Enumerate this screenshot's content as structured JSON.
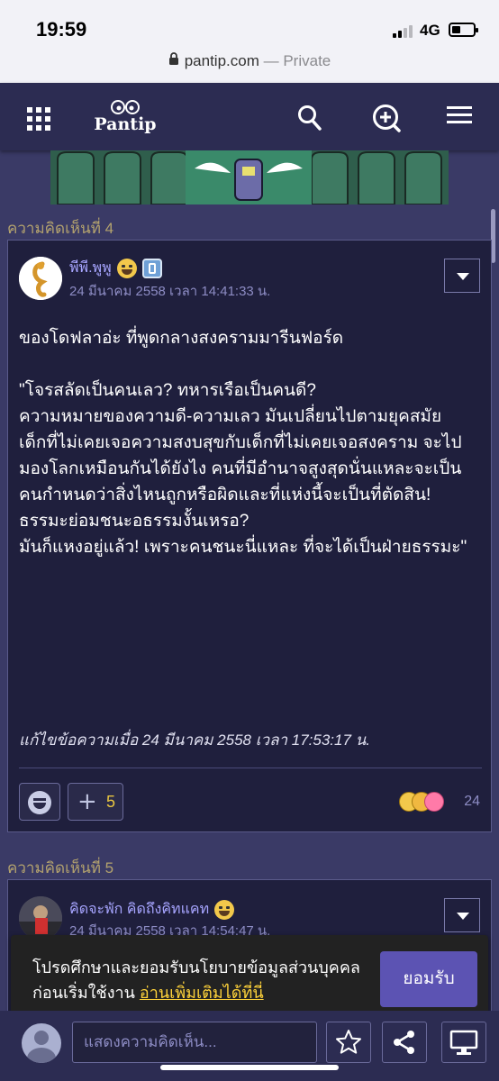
{
  "status_bar": {
    "time": "19:59",
    "network": "4G"
  },
  "url_bar": {
    "domain": "pantip.com",
    "separator": " — ",
    "mode": "Private"
  },
  "header": {
    "logo_text": "Pantip",
    "icons": [
      "grid-icon",
      "search-icon",
      "new-post-icon",
      "menu-icon"
    ]
  },
  "comments": [
    {
      "label": "ความคิดเห็นที่ 4",
      "user": "พีพี.พูพู",
      "time": "24 มีนาคม 2558 เวลา 14:41:33 น.",
      "body": [
        "ของโดฟลาอ่ะ ที่พูดกลางสงครามมารีนฟอร์ด",
        "",
        "\"โจรสลัดเป็นคนเลว? ทหารเรือเป็นคนดี?",
        "ความหมายของความดี-ความเลว มันเปลี่ยนไปตามยุคสมัย",
        "เด็กที่ไม่เคยเจอความสงบสุขกับเด็กที่ไม่เคยเจอสงคราม จะไปมองโลกเหมือนกันได้ยังไง คนที่มีอำนาจสูงสุดนั่นแหละจะเป็นคนกำหนดว่าสิ่งไหนถูกหรือผิดและที่แห่งนี้จะเป็นที่ตัดสิน!",
        "ธรรมะย่อมชนะอธรรมงั้นเหรอ?",
        "มันก็แหงอยู่แล้ว! เพราะคนชนะนี่แหละ ที่จะได้เป็นฝ่ายธรรมะ\""
      ],
      "edit_note": "แก้ไขข้อความเมื่อ 24 มีนาคม 2558 เวลา 17:53:17 น.",
      "plus_count": "5",
      "reaction_count": "24"
    },
    {
      "label": "ความคิดเห็นที่ 5",
      "user": "คิดจะพัก คิดถึงคิทแคท",
      "time": "24 มีนาคม 2558 เวลา 14:54:47 น."
    }
  ],
  "cookie": {
    "text": "โปรดศึกษาและยอมรับนโยบายข้อมูลส่วนบุคคลก่อนเริ่มใช้งาน ",
    "link": "อ่านเพิ่มเติมได้ที่นี่",
    "accept_label": "ยอมรับ"
  },
  "bottom_bar": {
    "comment_placeholder": "แสดงความคิดเห็น...",
    "icons": [
      "star-icon",
      "share-icon",
      "desktop-icon"
    ]
  },
  "colors": {
    "background": "#3a3a66",
    "card": "#1f1f3d",
    "header": "#2c2c52",
    "username": "#a7a5ff",
    "section_label": "#b3a26e",
    "accept": "#5c53b3",
    "link": "#ffd33a"
  }
}
